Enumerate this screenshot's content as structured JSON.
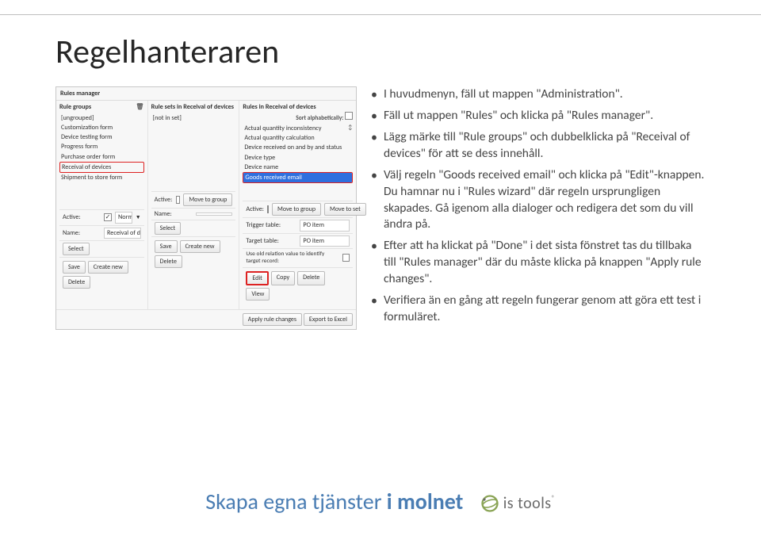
{
  "title": "Regelhanteraren",
  "bullets": [
    "I huvudmenyn, fäll ut mappen \"Administration\".",
    "Fäll ut mappen \"Rules\" och klicka på \"Rules manager\".",
    "Lägg märke till \"Rule groups\" och dubbelklicka på \"Receival of devices\" för att se dess innehåll.",
    "Välj regeln \"Goods received email\" och klicka på \"Edit\"-knappen. Du hamnar nu i \"Rules wizard\" där regeln ursprungligen skapades. Gå igenom alla dialoger och redigera det som du vill ändra på.",
    "Efter att ha klickat på \"Done\" i det sista fönstret tas du tillbaka till \"Rules manager\" där du måste klicka på knappen \"Apply rule changes\".",
    "Verifiera än en gång att regeln fungerar genom att göra ett test i formuläret."
  ],
  "screenshot": {
    "title": "Rules manager",
    "col1": {
      "head": "Rule groups",
      "items": [
        "[ungrouped]",
        "Customization form",
        "Device testing form",
        "Progress form",
        "Purchase order form",
        "Receival of devices",
        "Shipment to store form"
      ],
      "selectedIndex": 5,
      "trash": "🗑",
      "active_label": "Active:",
      "active_checked": "✓",
      "normal": "Normal",
      "name_label": "Name:",
      "name_value": "Receival of devices",
      "select_btn": "Select",
      "btns": [
        "Save",
        "Create new",
        "Delete"
      ]
    },
    "col2": {
      "head": "Rule sets in Receival of devices",
      "items": [
        "[not in set]"
      ],
      "active_label": "Active:",
      "move_btn": "Move to group",
      "name_label": "Name:",
      "select_btn": "Select",
      "btns": [
        "Save",
        "Create new",
        "Delete"
      ]
    },
    "col3": {
      "head": "Rules in Receival of devices",
      "sort": "Sort alphabetically:",
      "items": [
        "Actual quantity inconsistency",
        "Actual quantity calculation",
        "Device received on and by and status",
        "Device type",
        "Device name",
        "Goods received email"
      ],
      "selectedIndex": 5,
      "updn": "↕",
      "active_label": "Active:",
      "move_group_btn": "Move to group",
      "move_set_btn": "Move to set",
      "trigger_label": "Trigger table:",
      "trigger_value": "PO item",
      "target_label": "Target table:",
      "target_value": "PO item",
      "oldrel_label": "Use old relation value to identify target record:",
      "btns": [
        "Edit",
        "Copy",
        "Delete",
        "View"
      ],
      "edit_hl_index": 0
    },
    "bottom_right": [
      "Apply rule changes",
      "Export to Excel"
    ]
  },
  "footer": {
    "part1": "Skapa egna tjänster ",
    "part2": "i molnet",
    "logo_text": "is tools",
    "reg": "®"
  }
}
